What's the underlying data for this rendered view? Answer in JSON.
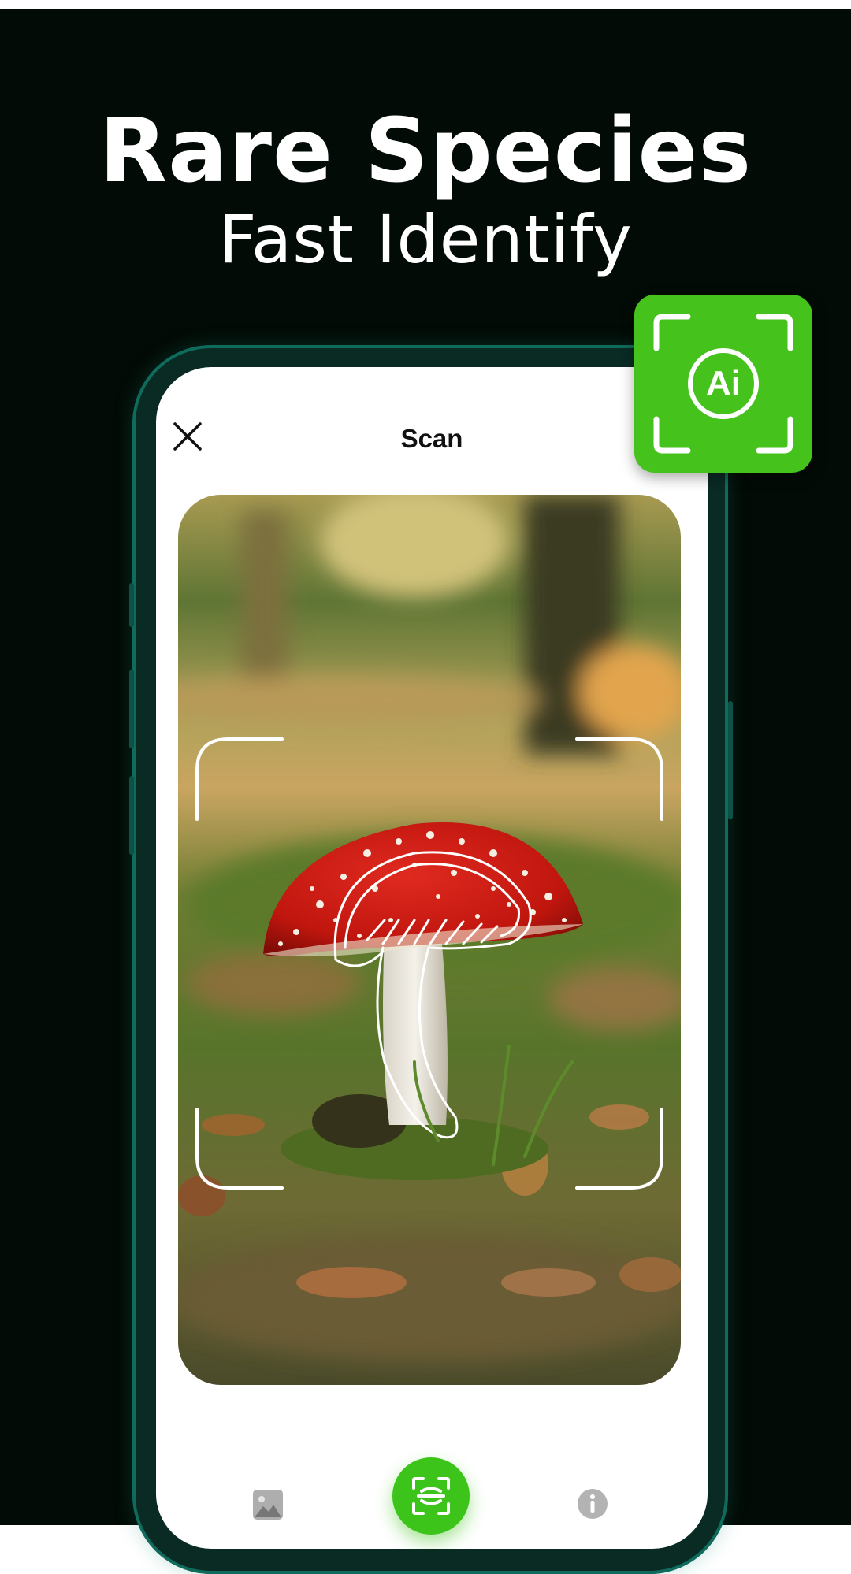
{
  "headline": {
    "title": "Rare Species",
    "subtitle": "Fast Identify"
  },
  "badge": {
    "label": "Ai",
    "icon": "ai-scan-icon",
    "color": "#46c21c"
  },
  "scan_screen": {
    "title": "Scan",
    "close_icon": "close-icon",
    "photo_subject": "mushroom",
    "bottom_bar": {
      "gallery_icon": "gallery-icon",
      "scan_icon": "scan-icon",
      "info_icon": "info-icon"
    }
  },
  "colors": {
    "background": "#030b06",
    "accent": "#3dc41b",
    "phone_frame": "#0f6b5b"
  }
}
